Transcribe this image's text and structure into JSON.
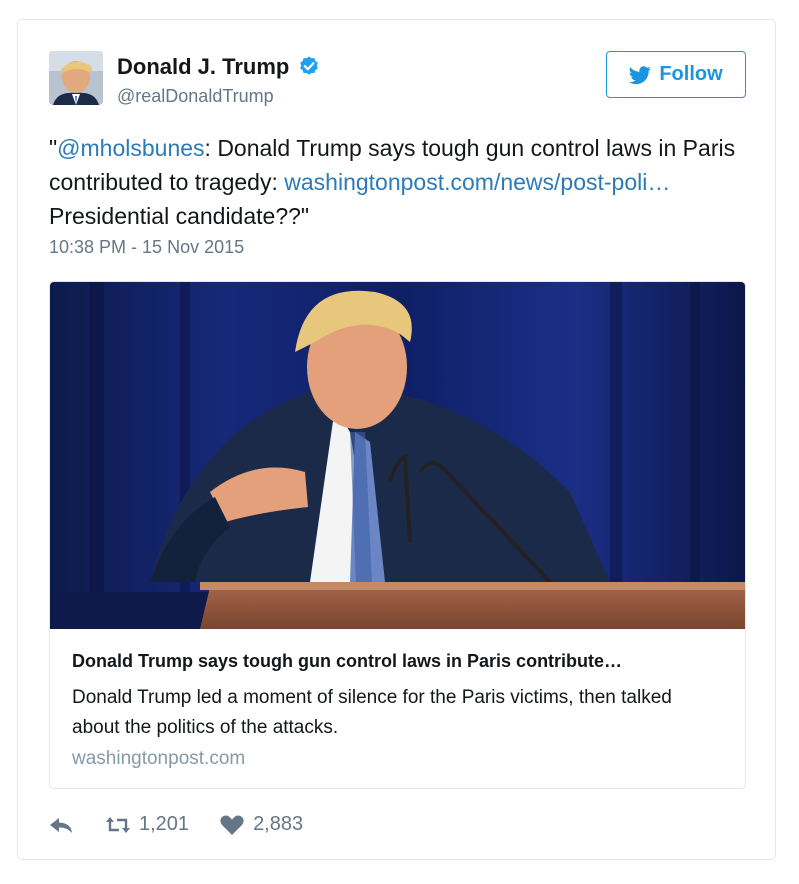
{
  "user": {
    "name": "Donald J. Trump",
    "handle": "@realDonaldTrump"
  },
  "follow_label": "Follow",
  "tweet": {
    "text_open": "\"",
    "mention": "@mholsbunes",
    "text_mid": ": Donald Trump says tough gun control laws in Paris contributed to tragedy: ",
    "link": "washingtonpost.com/news/post-poli…",
    "text_end": " Presidential candidate??\"",
    "timestamp": "10:38 PM - 15 Nov 2015"
  },
  "card": {
    "title": "Donald Trump says tough gun control laws in Paris contribute…",
    "description": "Donald Trump led a moment of silence for the Paris victims, then talked about the politics of the attacks.",
    "domain": "washingtonpost.com"
  },
  "actions": {
    "retweets": "1,201",
    "likes": "2,883"
  },
  "colors": {
    "link": "#2b7bb9",
    "follow": "#1b95e0",
    "muted": "#657786",
    "border": "#e1e8ed"
  },
  "icons": [
    "verified-badge-icon",
    "twitter-bird-icon",
    "reply-icon",
    "retweet-icon",
    "heart-icon"
  ]
}
